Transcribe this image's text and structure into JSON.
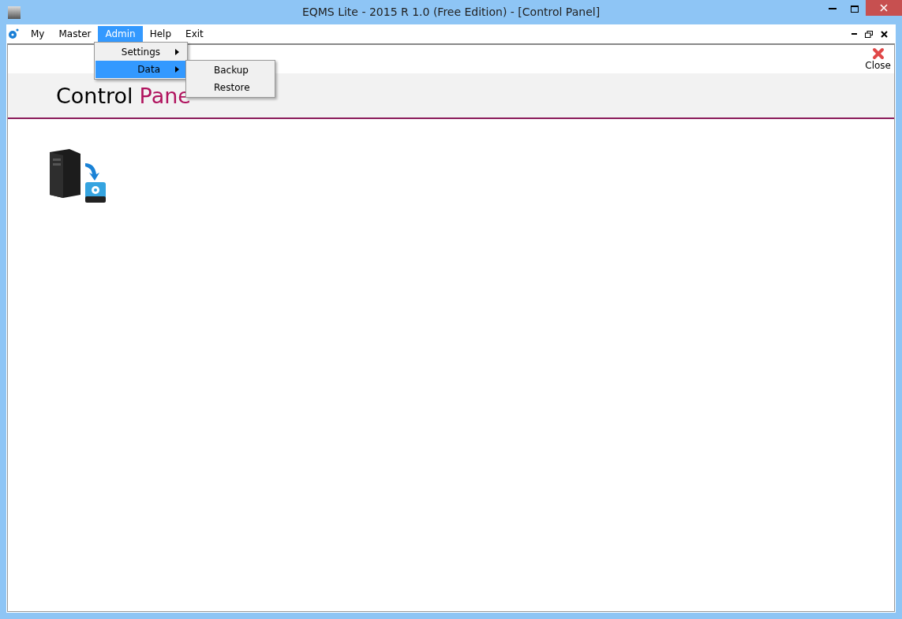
{
  "window": {
    "title": "EQMS Lite - 2015 R 1.0 (Free Edition)  - [Control Panel]"
  },
  "menubar": {
    "items": [
      {
        "label": "My",
        "selected": false
      },
      {
        "label": "Master",
        "selected": false
      },
      {
        "label": "Admin",
        "selected": true
      },
      {
        "label": "Help",
        "selected": false
      },
      {
        "label": "Exit",
        "selected": false
      }
    ]
  },
  "dropdown": {
    "items": [
      {
        "label": "Settings",
        "has_submenu": true,
        "selected": false
      },
      {
        "label": "Data",
        "has_submenu": true,
        "selected": true
      }
    ]
  },
  "submenu": {
    "items": [
      {
        "label": "Backup"
      },
      {
        "label": "Restore"
      }
    ]
  },
  "close_button": {
    "label": "Close"
  },
  "page_title": {
    "first": "Control",
    "second": "Pane"
  }
}
